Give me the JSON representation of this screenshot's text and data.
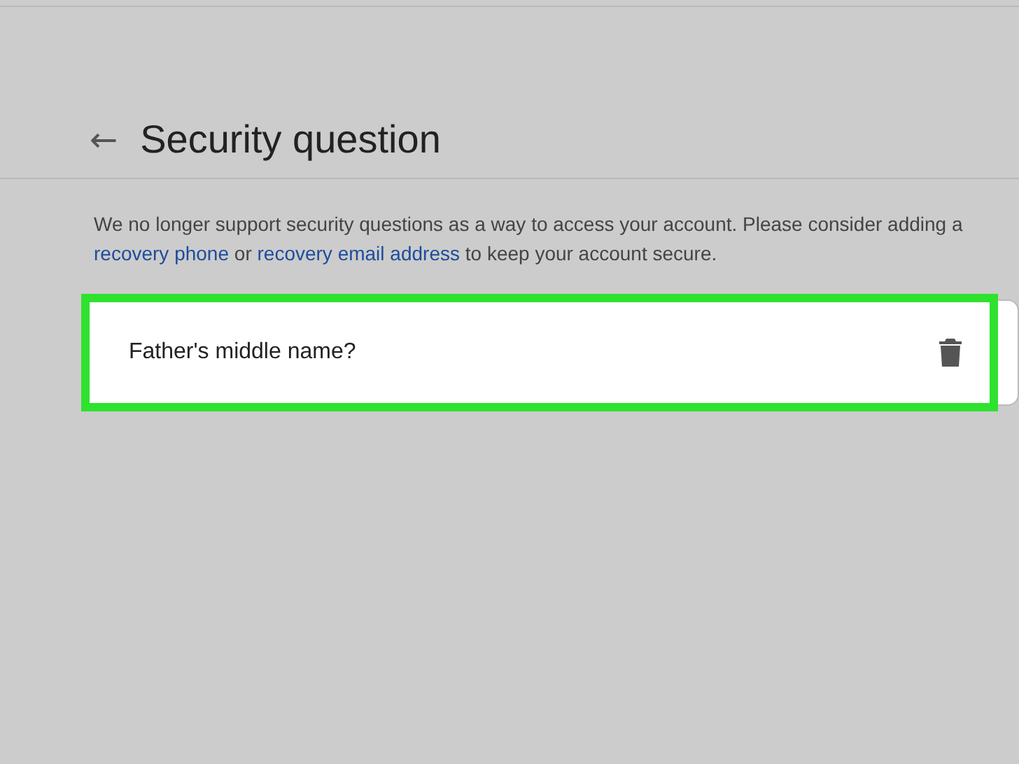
{
  "header": {
    "back_icon": "←",
    "title": "Security question"
  },
  "notice": [
    {
      "kind": "text",
      "text": "We no longer support security questions as a way to access your account. Please consider adding a "
    },
    {
      "kind": "link",
      "text": "recovery phone"
    },
    {
      "kind": "text",
      "text": " or "
    },
    {
      "kind": "link",
      "text": "recovery email address"
    },
    {
      "kind": "text",
      "text": " to keep your account secure."
    }
  ],
  "question": {
    "text": "Father's middle name?",
    "highlighted": true
  }
}
